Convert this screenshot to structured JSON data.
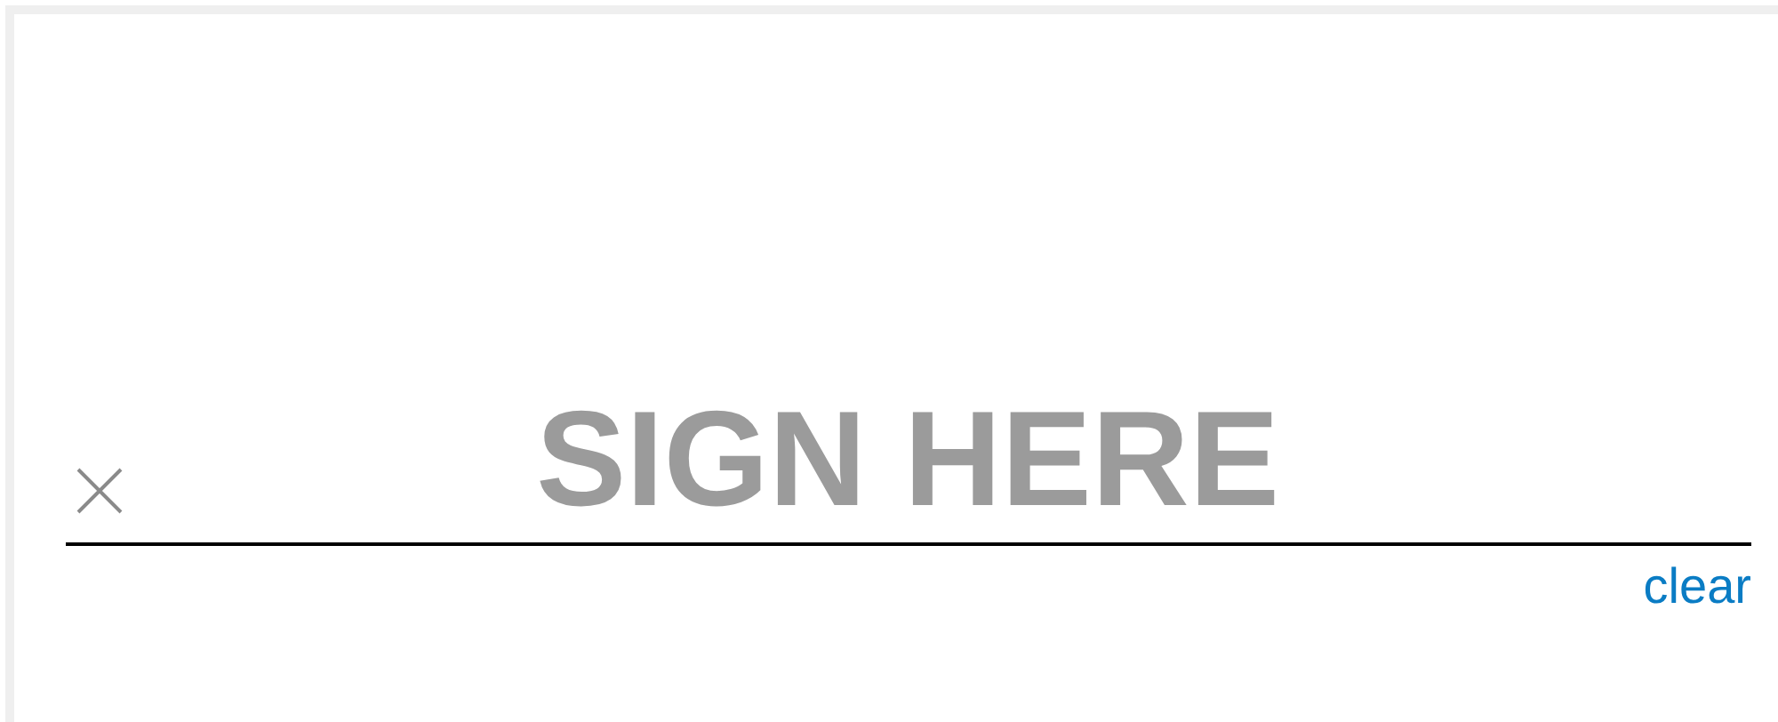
{
  "signature_pad": {
    "placeholder": "SIGN HERE",
    "clear_link": "clear"
  }
}
